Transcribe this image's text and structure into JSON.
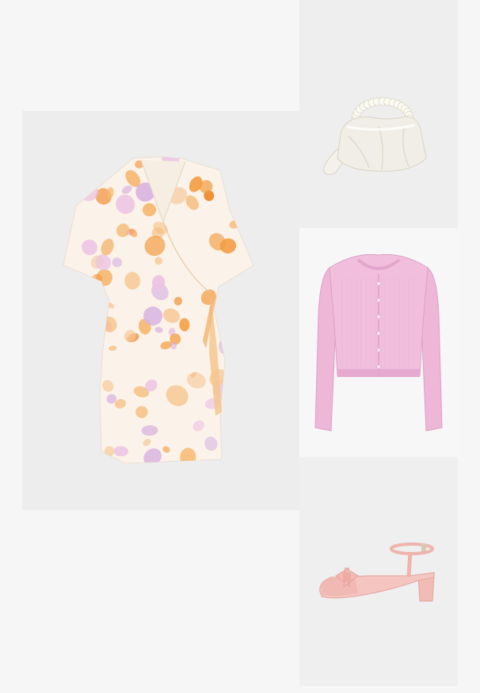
{
  "outfit": {
    "items": [
      {
        "name": "floral-wrap-dress",
        "colors": [
          "#fbf3ea",
          "#f39a3c",
          "#f6b872",
          "#d8b3e0"
        ]
      },
      {
        "name": "pearl-handle-bag",
        "colors": [
          "#f0eee6",
          "#e2dfd3",
          "#ffffff"
        ]
      },
      {
        "name": "pink-cardigan",
        "colors": [
          "#f1bfdd",
          "#e6a9cf",
          "#fbe3f1"
        ]
      },
      {
        "name": "pink-bow-heel",
        "colors": [
          "#f5c6c1",
          "#eeb0aa",
          "#fde7e2"
        ]
      }
    ]
  }
}
